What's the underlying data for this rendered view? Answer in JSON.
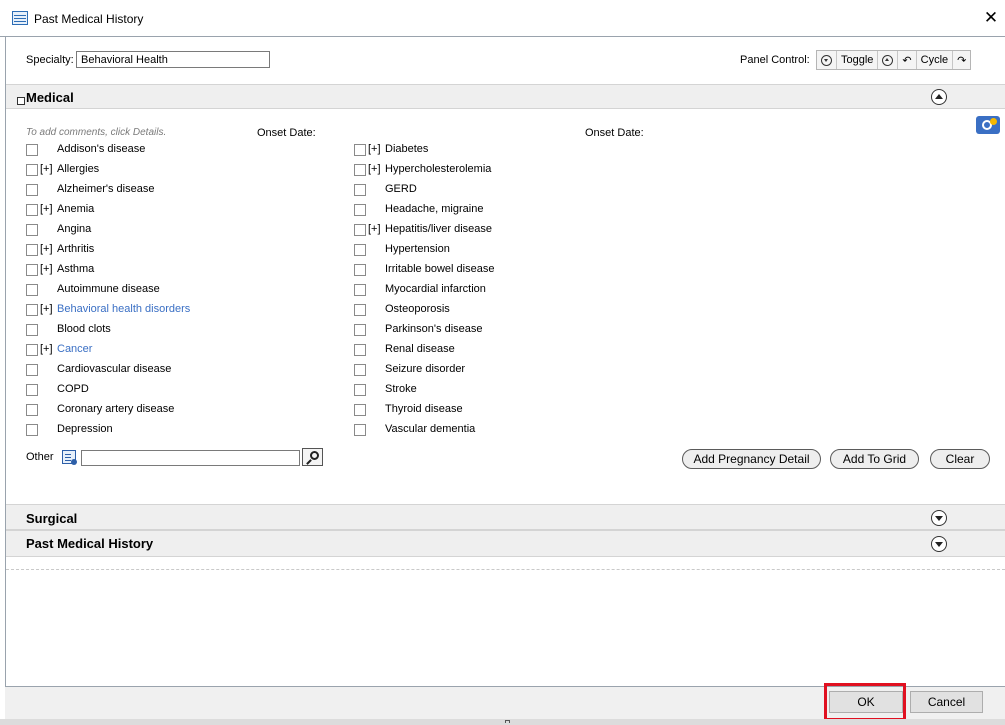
{
  "window": {
    "title": "Past Medical History"
  },
  "toolbar": {
    "specialty_label": "Specialty:",
    "specialty_value": "Behavioral Health",
    "panel_control_label": "Panel Control:",
    "toggle_label": "Toggle",
    "cycle_label": "Cycle"
  },
  "sections": {
    "medical_title": "Medical",
    "surgical_title": "Surgical",
    "pmh_title": "Past Medical History"
  },
  "medical": {
    "hint": "To add comments, click Details.",
    "onset_date_label": "Onset Date:",
    "left_items": [
      {
        "label": "Addison's disease",
        "expand": ""
      },
      {
        "label": "Allergies",
        "expand": "[+]"
      },
      {
        "label": "Alzheimer's disease",
        "expand": ""
      },
      {
        "label": "Anemia",
        "expand": "[+]"
      },
      {
        "label": "Angina",
        "expand": ""
      },
      {
        "label": "Arthritis",
        "expand": "[+]"
      },
      {
        "label": "Asthma",
        "expand": "[+]"
      },
      {
        "label": "Autoimmune disease",
        "expand": ""
      },
      {
        "label": "Behavioral health disorders",
        "expand": "[+]"
      },
      {
        "label": "Blood clots",
        "expand": ""
      },
      {
        "label": "Cancer",
        "expand": "[+]"
      },
      {
        "label": "Cardiovascular disease",
        "expand": ""
      },
      {
        "label": "COPD",
        "expand": ""
      },
      {
        "label": "Coronary artery disease",
        "expand": ""
      },
      {
        "label": "Depression",
        "expand": ""
      }
    ],
    "right_items": [
      {
        "label": "Diabetes",
        "expand": "[+]"
      },
      {
        "label": "Hypercholesterolemia",
        "expand": "[+]"
      },
      {
        "label": "GERD",
        "expand": ""
      },
      {
        "label": "Headache, migraine",
        "expand": ""
      },
      {
        "label": "Hepatitis/liver disease",
        "expand": "[+]"
      },
      {
        "label": "Hypertension",
        "expand": ""
      },
      {
        "label": "Irritable bowel disease",
        "expand": ""
      },
      {
        "label": "Myocardial infarction",
        "expand": ""
      },
      {
        "label": "Osteoporosis",
        "expand": ""
      },
      {
        "label": "Parkinson's disease",
        "expand": ""
      },
      {
        "label": "Renal disease",
        "expand": ""
      },
      {
        "label": "Seizure disorder",
        "expand": ""
      },
      {
        "label": "Stroke",
        "expand": ""
      },
      {
        "label": "Thyroid disease",
        "expand": ""
      },
      {
        "label": "Vascular dementia",
        "expand": ""
      }
    ],
    "other_label": "Other",
    "other_value": "",
    "add_pregnancy_label": "Add Pregnancy Detail",
    "add_to_grid_label": "Add To Grid",
    "clear_label": "Clear"
  },
  "footer": {
    "ok_label": "OK",
    "cancel_label": "Cancel"
  },
  "colors": {
    "link": "#3a6fc4",
    "highlight": "#e01020",
    "section_bg": "#efefef"
  }
}
